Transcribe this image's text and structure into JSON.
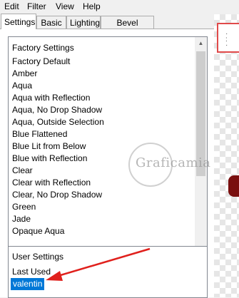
{
  "menu": [
    "Edit",
    "Filter",
    "View",
    "Help"
  ],
  "tabs": [
    {
      "label": "Settings",
      "active": true
    },
    {
      "label": "Basic",
      "active": false
    },
    {
      "label": "Lighting",
      "active": false
    },
    {
      "label": "Bevel Profile",
      "active": false
    }
  ],
  "factory_settings": {
    "header": "Factory Settings",
    "items": [
      "Factory Default",
      "Amber",
      "Aqua",
      "Aqua with Reflection",
      "Aqua, No Drop Shadow",
      "Aqua, Outside Selection",
      "Blue Flattened",
      "Blue Lit from Below",
      "Blue with Reflection",
      "Clear",
      "Clear with Reflection",
      "Clear, No Drop Shadow",
      "Green",
      "Jade",
      "Opaque Aqua"
    ]
  },
  "user_settings": {
    "header": "User Settings",
    "items": [
      "Last Used",
      "valentin"
    ],
    "selected": "valentin"
  },
  "watermark": "Graficamia",
  "colors": {
    "selection": "#0078d7",
    "arrow": "#e0201c",
    "preview_border": "#e04a4a"
  }
}
